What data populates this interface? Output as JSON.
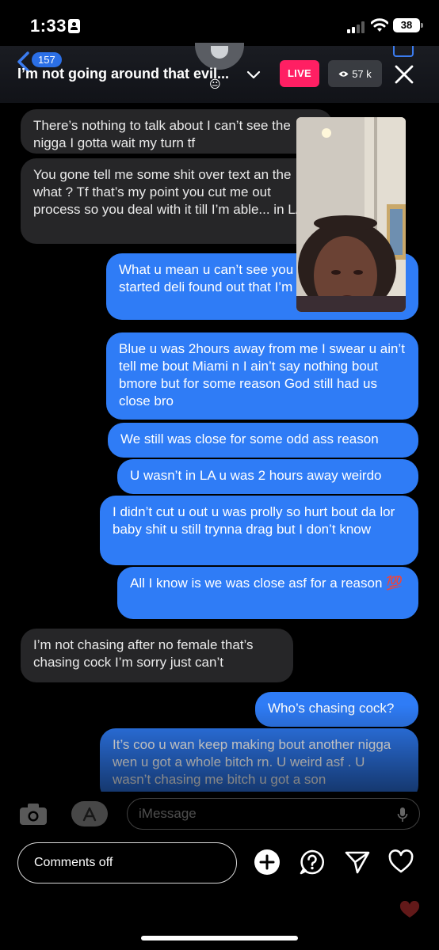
{
  "status_bar": {
    "time": "1:33",
    "battery": "38"
  },
  "header": {
    "back_count": "157",
    "stream_title": "I’m not going around that evil...",
    "emoji": "😐",
    "live_label": "LIVE",
    "viewers": "57 k"
  },
  "messages": [
    {
      "side": "incoming",
      "text": "There’s nothing to talk about I can’t see the nigga I gotta wait my turn tf"
    },
    {
      "side": "incoming",
      "text": "You gone tell me some shit over text an the what ? Tf that’s my point you cut me out process so you deal with it till I’m able... in LA"
    },
    {
      "side": "outgoing",
      "text": "What u mean u can’t see you calling u befor I started deli found out that I’m 2cm dial"
    },
    {
      "side": "outgoing",
      "text": "Blue u was 2hours away from me I swear u ain’t tell me bout Miami n I ain’t say nothing bout bmore but for some reason God still had us close bro"
    },
    {
      "side": "outgoing",
      "text": "We still was close for some odd ass reason"
    },
    {
      "side": "outgoing",
      "text": "U wasn’t in LA u was 2 hours away weirdo"
    },
    {
      "side": "outgoing",
      "text": "I didn’t cut u out u was prolly so hurt bout da lor baby shit u still trynna drag but I don’t know"
    },
    {
      "side": "outgoing",
      "text": "All I know is we was close asf for a reason 💯"
    },
    {
      "side": "incoming",
      "text": "I’m not chasing after no female that’s chasing cock I’m sorry just can’t"
    },
    {
      "side": "outgoing",
      "text": "Who’s chasing cock?"
    },
    {
      "side": "outgoing",
      "text": "It’s coo u wan keep making bout another nigga wen u got a whole bitch rn. U weird asf . U wasn’t chasing me bitch u got a son"
    }
  ],
  "imessage": {
    "placeholder": "iMessage"
  },
  "bottom_bar": {
    "comments_label": "Comments off"
  },
  "colors": {
    "live_red": "#ff1f63",
    "imessage_blue": "#2f7cf6",
    "incoming_gray": "#262628",
    "badge_blue": "#2b6fe6"
  },
  "icons": [
    "id-card-icon",
    "cellular-signal-icon",
    "wifi-icon",
    "battery-icon",
    "back-chevron-icon",
    "video-camera-icon",
    "chevron-down-icon",
    "eye-icon",
    "close-icon",
    "camera-icon",
    "app-store-icon",
    "microphone-icon",
    "add-icon",
    "question-icon",
    "send-icon",
    "heart-icon"
  ]
}
